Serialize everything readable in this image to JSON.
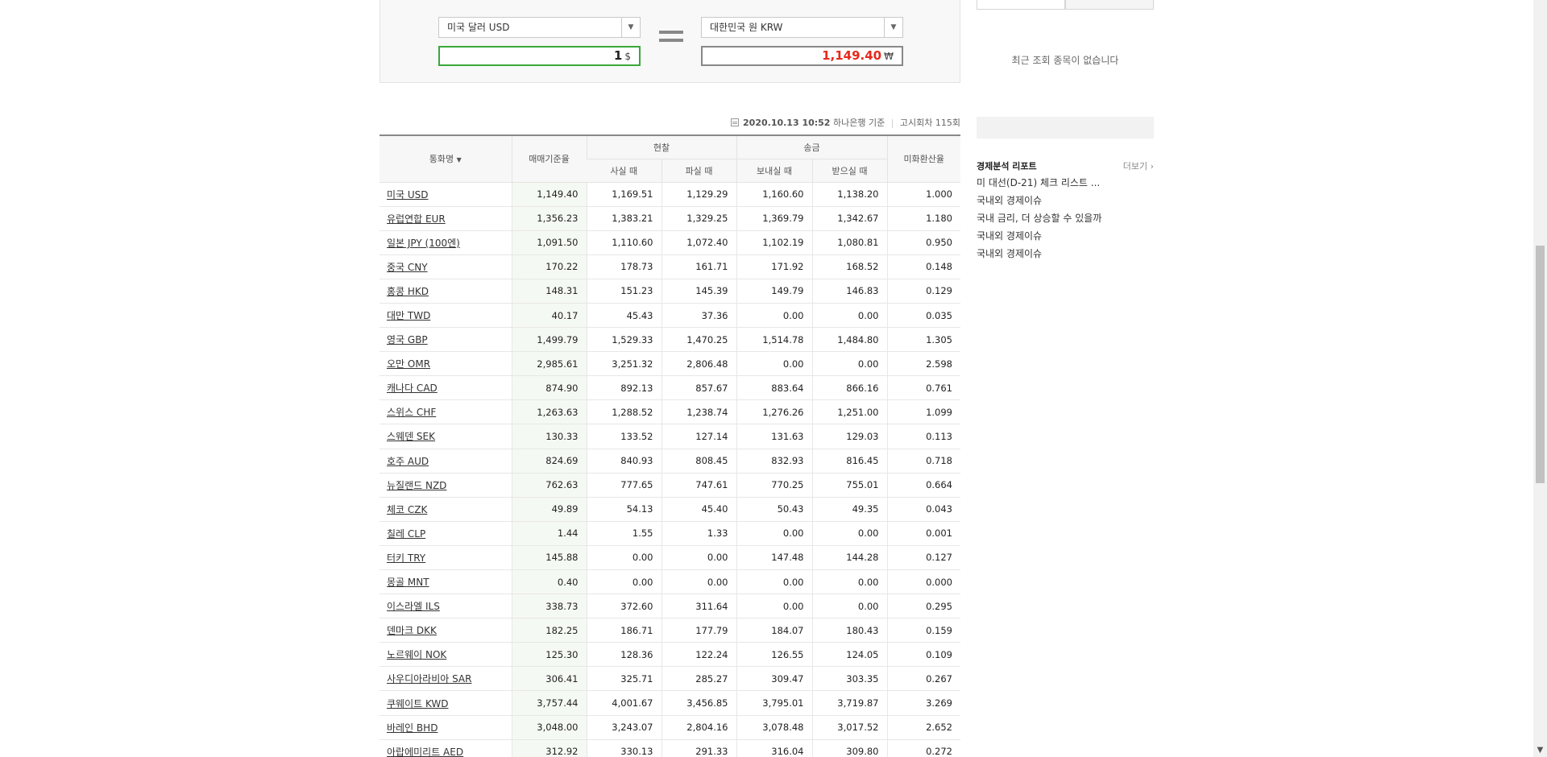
{
  "converter": {
    "from_currency": "미국 달러 USD",
    "to_currency": "대한민국 원 KRW",
    "from_amount": "1",
    "from_unit": "$",
    "to_amount": "1,149.40",
    "to_unit": "₩"
  },
  "meta": {
    "date": "2020.10.13 10:52",
    "source": "하나은행 기준",
    "notice": "고시회차 115회"
  },
  "table": {
    "headers": {
      "currency": "통화명",
      "base_rate": "매매기준율",
      "cash": "현찰",
      "cash_buy": "사실 때",
      "cash_sell": "파실 때",
      "transfer": "송금",
      "send": "보내실 때",
      "receive": "받으실 때",
      "usd_ratio": "미화환산율"
    },
    "rows": [
      [
        "미국 USD",
        "1,149.40",
        "1,169.51",
        "1,129.29",
        "1,160.60",
        "1,138.20",
        "1.000"
      ],
      [
        "유럽연합 EUR",
        "1,356.23",
        "1,383.21",
        "1,329.25",
        "1,369.79",
        "1,342.67",
        "1.180"
      ],
      [
        "일본 JPY (100엔)",
        "1,091.50",
        "1,110.60",
        "1,072.40",
        "1,102.19",
        "1,080.81",
        "0.950"
      ],
      [
        "중국 CNY",
        "170.22",
        "178.73",
        "161.71",
        "171.92",
        "168.52",
        "0.148"
      ],
      [
        "홍콩 HKD",
        "148.31",
        "151.23",
        "145.39",
        "149.79",
        "146.83",
        "0.129"
      ],
      [
        "대만 TWD",
        "40.17",
        "45.43",
        "37.36",
        "0.00",
        "0.00",
        "0.035"
      ],
      [
        "영국 GBP",
        "1,499.79",
        "1,529.33",
        "1,470.25",
        "1,514.78",
        "1,484.80",
        "1.305"
      ],
      [
        "오만 OMR",
        "2,985.61",
        "3,251.32",
        "2,806.48",
        "0.00",
        "0.00",
        "2.598"
      ],
      [
        "캐나다 CAD",
        "874.90",
        "892.13",
        "857.67",
        "883.64",
        "866.16",
        "0.761"
      ],
      [
        "스위스 CHF",
        "1,263.63",
        "1,288.52",
        "1,238.74",
        "1,276.26",
        "1,251.00",
        "1.099"
      ],
      [
        "스웨덴 SEK",
        "130.33",
        "133.52",
        "127.14",
        "131.63",
        "129.03",
        "0.113"
      ],
      [
        "호주 AUD",
        "824.69",
        "840.93",
        "808.45",
        "832.93",
        "816.45",
        "0.718"
      ],
      [
        "뉴질랜드 NZD",
        "762.63",
        "777.65",
        "747.61",
        "770.25",
        "755.01",
        "0.664"
      ],
      [
        "체코 CZK",
        "49.89",
        "54.13",
        "45.40",
        "50.43",
        "49.35",
        "0.043"
      ],
      [
        "칠레 CLP",
        "1.44",
        "1.55",
        "1.33",
        "0.00",
        "0.00",
        "0.001"
      ],
      [
        "터키 TRY",
        "145.88",
        "0.00",
        "0.00",
        "147.48",
        "144.28",
        "0.127"
      ],
      [
        "몽골 MNT",
        "0.40",
        "0.00",
        "0.00",
        "0.00",
        "0.00",
        "0.000"
      ],
      [
        "이스라엘 ILS",
        "338.73",
        "372.60",
        "311.64",
        "0.00",
        "0.00",
        "0.295"
      ],
      [
        "덴마크 DKK",
        "182.25",
        "186.71",
        "177.79",
        "184.07",
        "180.43",
        "0.159"
      ],
      [
        "노르웨이 NOK",
        "125.30",
        "128.36",
        "122.24",
        "126.55",
        "124.05",
        "0.109"
      ],
      [
        "사우디아라비아 SAR",
        "306.41",
        "325.71",
        "285.27",
        "309.47",
        "303.35",
        "0.267"
      ],
      [
        "쿠웨이트 KWD",
        "3,757.44",
        "4,001.67",
        "3,456.85",
        "3,795.01",
        "3,719.87",
        "3.269"
      ],
      [
        "바레인 BHD",
        "3,048.00",
        "3,243.07",
        "2,804.16",
        "3,078.48",
        "3,017.52",
        "2.652"
      ],
      [
        "아랍에미리트 AED",
        "312.92",
        "330.13",
        "291.33",
        "316.04",
        "309.80",
        "0.272"
      ]
    ]
  },
  "sidebar": {
    "recent_empty": "최근 조회 종목이 없습니다",
    "report_title": "경제분석 리포트",
    "report_more": "더보기",
    "reports": [
      "미 대선(D-21) 체크 리스트 ...",
      "국내외 경제이슈",
      "국내 금리, 더 상승할 수 있을까",
      "국내외 경제이슈",
      "국내외 경제이슈"
    ]
  }
}
